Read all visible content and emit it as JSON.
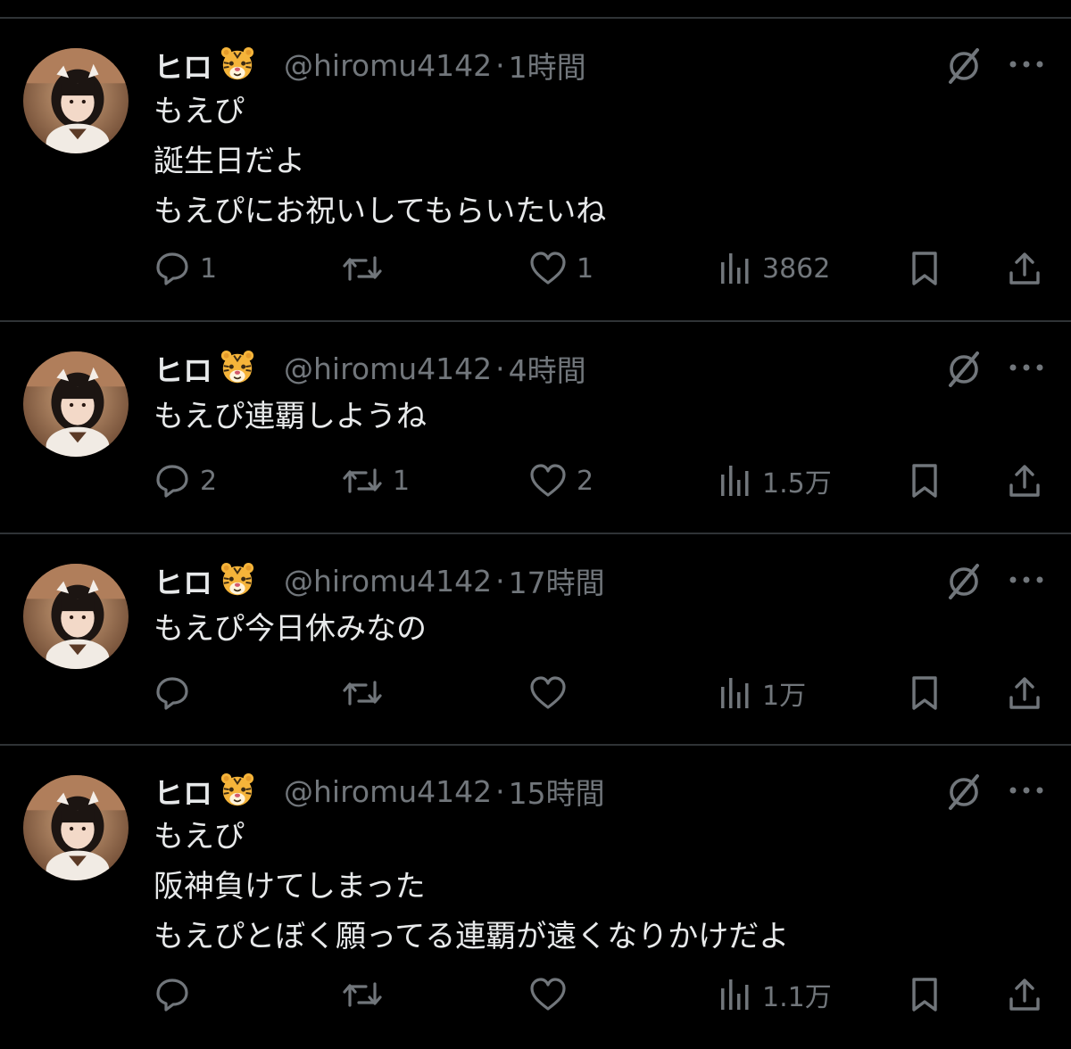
{
  "colors": {
    "background": "#000000",
    "divider": "#2f3336",
    "primary_text": "#e7e9ea",
    "secondary_text": "#71767b"
  },
  "tweets": [
    {
      "name": "ヒロ",
      "emoji": "tiger-face-icon",
      "handle": "@hiromu4142",
      "separator": "·",
      "time": "1時間",
      "lines": [
        "もえぴ",
        "誕生日だよ",
        "もえぴにお祝いしてもらいたいね"
      ],
      "replies": "1",
      "retweets": "",
      "likes": "1",
      "views": "3862"
    },
    {
      "name": "ヒロ",
      "emoji": "tiger-face-icon",
      "handle": "@hiromu4142",
      "separator": "·",
      "time": "4時間",
      "lines": [
        "もえぴ連覇しようね"
      ],
      "replies": "2",
      "retweets": "1",
      "likes": "2",
      "views": "1.5万"
    },
    {
      "name": "ヒロ",
      "emoji": "tiger-face-icon",
      "handle": "@hiromu4142",
      "separator": "·",
      "time": "17時間",
      "lines": [
        "もえぴ今日休みなの"
      ],
      "replies": "",
      "retweets": "",
      "likes": "",
      "views": "1万"
    },
    {
      "name": "ヒロ",
      "emoji": "tiger-face-icon",
      "handle": "@hiromu4142",
      "separator": "·",
      "time": "15時間",
      "lines": [
        "もえぴ",
        "阪神負けてしまった",
        "もえぴとぼく願ってる連覇が遠くなりかけだよ"
      ],
      "replies": "",
      "retweets": "",
      "likes": "",
      "views": "1.1万"
    }
  ]
}
